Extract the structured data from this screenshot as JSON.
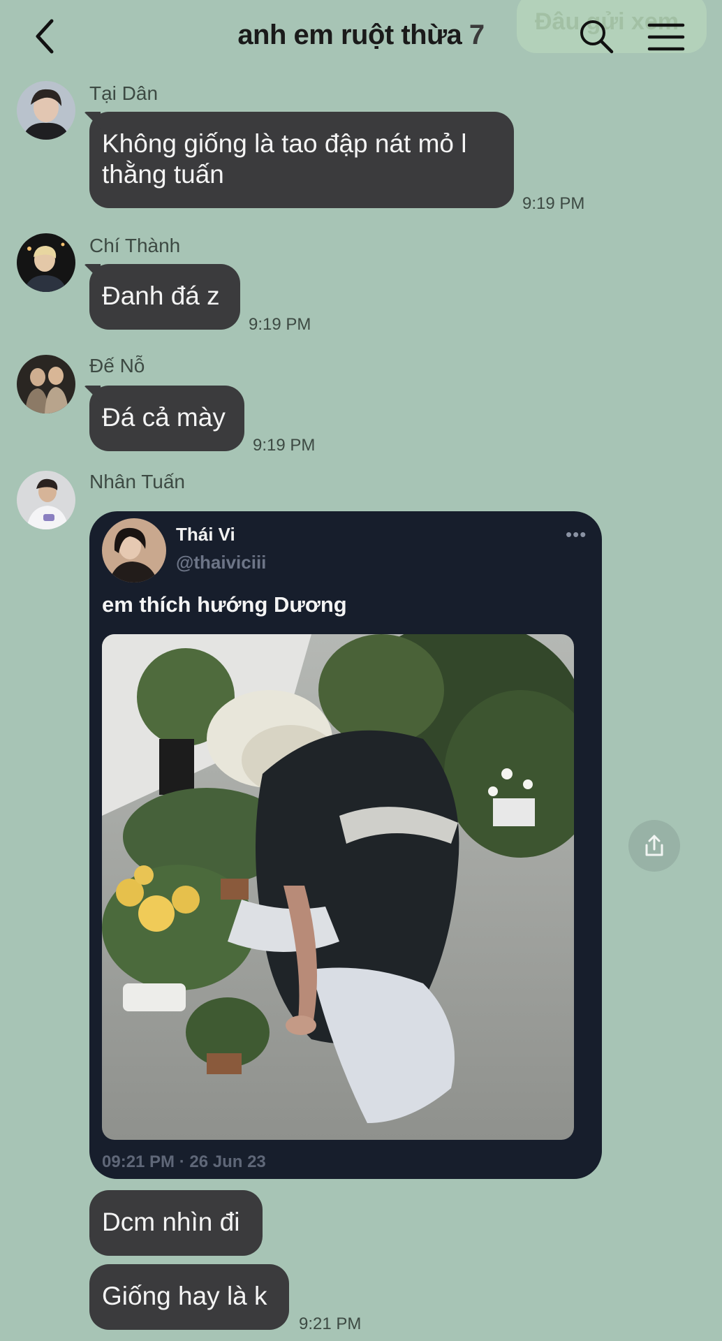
{
  "header": {
    "title": "anh em ruột thừa",
    "member_count": "7",
    "ghost_button_label": "Đâu gửi xem",
    "icons": [
      "back-chevron-icon",
      "search-icon",
      "menu-icon"
    ]
  },
  "messages": [
    {
      "sender": "Tại Dân",
      "text_line1": "Không giống là tao đập nát mỏ l",
      "text_line2": "thằng tuấn",
      "time": "9:19 PM"
    },
    {
      "sender": "Chí Thành",
      "text": "Đanh đá z",
      "time": "9:19 PM"
    },
    {
      "sender": "Đế Nỗ",
      "text": "Đá cả mày",
      "time": "9:19 PM"
    },
    {
      "sender": "Nhân Tuấn"
    }
  ],
  "tweet": {
    "author_name": "Thái Vi",
    "author_handle": "@thaiviciii",
    "more": "•••",
    "caption": "em thích hướng Dương",
    "date": "09:21 PM · 26 Jun 23"
  },
  "followups": [
    {
      "text": "Dcm nhìn đi"
    },
    {
      "text": "Giống hay là k",
      "time": "9:21 PM"
    }
  ],
  "share_icon": "share-icon"
}
